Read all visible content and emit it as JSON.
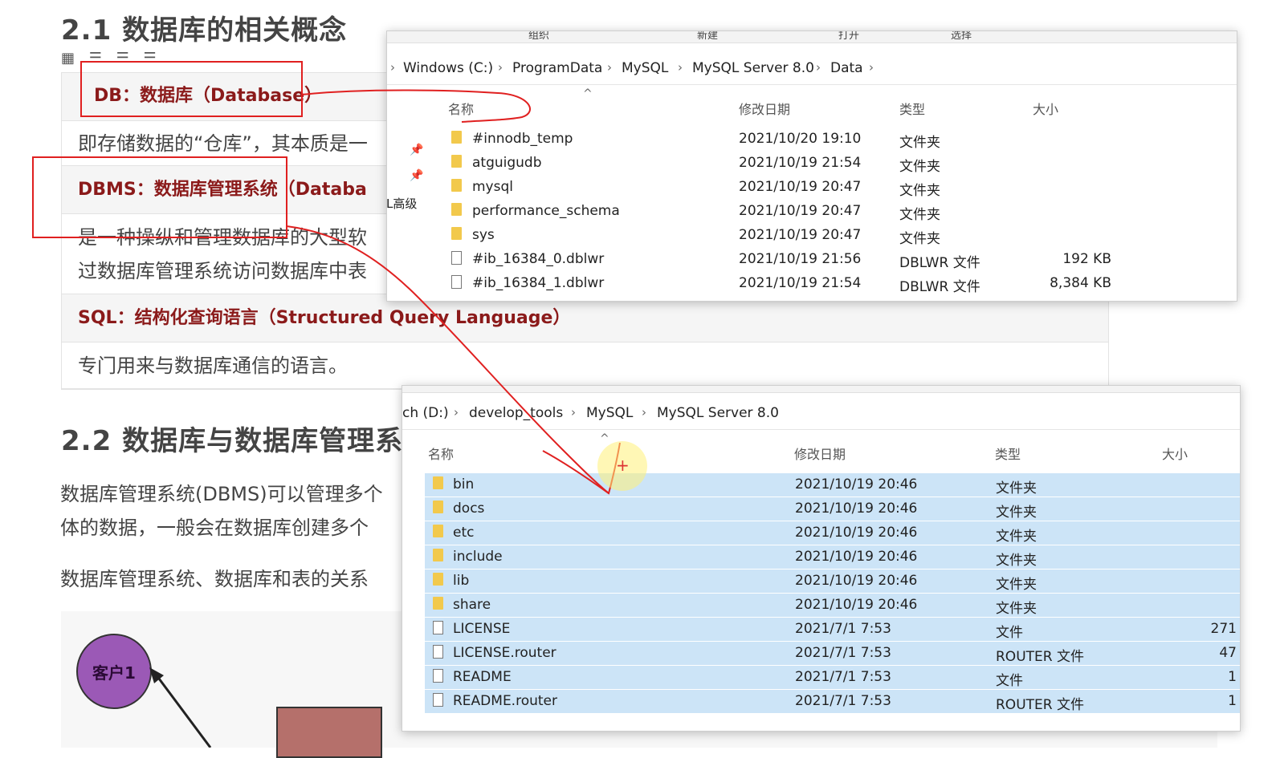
{
  "document": {
    "heading_21": "2.1 数据库的相关概念",
    "toolbar_icons": "▦ ☰ ☰ ☰",
    "definitions": [
      {
        "head": "DB：数据库（Database）",
        "body": "即存储数据的“仓库”，其本质是一"
      },
      {
        "head": "DBMS：数据库管理系统（Databa",
        "body": "是一种操纵和管理数据库的大型软",
        "body2": "过数据库管理系统访问数据库中表"
      },
      {
        "head": "SQL：结构化查询语言（Structured Query Language）",
        "body": "专门用来与数据库通信的语言。"
      }
    ],
    "heading_22": "2.2 数据库与数据库管理系",
    "para1_line1": "数据库管理系统(DBMS)可以管理多个",
    "para1_line2": "体的数据，一般会在数据库创建多个",
    "para2": "数据库管理系统、数据库和表的关系",
    "diagram": {
      "client_label": "客户1"
    }
  },
  "explorer_top": {
    "ribbon": [
      "组织",
      "新建",
      "打开",
      "选择"
    ],
    "breadcrumb": [
      "Windows (C:)",
      "ProgramData",
      "MySQL",
      "MySQL Server 8.0",
      "Data"
    ],
    "side_fragment": "L高级",
    "columns": {
      "name": "名称",
      "date": "修改日期",
      "type": "类型",
      "size": "大小"
    },
    "rows": [
      {
        "name": "#innodb_temp",
        "date": "2021/10/20 19:10",
        "type": "文件夹",
        "size": "",
        "kind": "folder"
      },
      {
        "name": "atguigudb",
        "date": "2021/10/19 21:54",
        "type": "文件夹",
        "size": "",
        "kind": "folder"
      },
      {
        "name": "mysql",
        "date": "2021/10/19 20:47",
        "type": "文件夹",
        "size": "",
        "kind": "folder"
      },
      {
        "name": "performance_schema",
        "date": "2021/10/19 20:47",
        "type": "文件夹",
        "size": "",
        "kind": "folder"
      },
      {
        "name": "sys",
        "date": "2021/10/19 20:47",
        "type": "文件夹",
        "size": "",
        "kind": "folder"
      },
      {
        "name": "#ib_16384_0.dblwr",
        "date": "2021/10/19 21:56",
        "type": "DBLWR 文件",
        "size": "192 KB",
        "kind": "file"
      },
      {
        "name": "#ib_16384_1.dblwr",
        "date": "2021/10/19 21:54",
        "type": "DBLWR 文件",
        "size": "8,384 KB",
        "kind": "file"
      }
    ]
  },
  "explorer_bottom": {
    "breadcrumb": [
      "ch (D:)",
      "develop_tools",
      "MySQL",
      "MySQL Server 8.0"
    ],
    "columns": {
      "name": "名称",
      "date": "修改日期",
      "type": "类型",
      "size": "大小"
    },
    "rows": [
      {
        "name": "bin",
        "date": "2021/10/19 20:46",
        "type": "文件夹",
        "size": "",
        "kind": "folder"
      },
      {
        "name": "docs",
        "date": "2021/10/19 20:46",
        "type": "文件夹",
        "size": "",
        "kind": "folder"
      },
      {
        "name": "etc",
        "date": "2021/10/19 20:46",
        "type": "文件夹",
        "size": "",
        "kind": "folder"
      },
      {
        "name": "include",
        "date": "2021/10/19 20:46",
        "type": "文件夹",
        "size": "",
        "kind": "folder"
      },
      {
        "name": "lib",
        "date": "2021/10/19 20:46",
        "type": "文件夹",
        "size": "",
        "kind": "folder"
      },
      {
        "name": "share",
        "date": "2021/10/19 20:46",
        "type": "文件夹",
        "size": "",
        "kind": "folder"
      },
      {
        "name": "LICENSE",
        "date": "2021/7/1 7:53",
        "type": "文件",
        "size": "271",
        "kind": "file"
      },
      {
        "name": "LICENSE.router",
        "date": "2021/7/1 7:53",
        "type": "ROUTER 文件",
        "size": "47",
        "kind": "file"
      },
      {
        "name": "README",
        "date": "2021/7/1 7:53",
        "type": "文件",
        "size": "1",
        "kind": "file"
      },
      {
        "name": "README.router",
        "date": "2021/7/1 7:53",
        "type": "ROUTER 文件",
        "size": "1",
        "kind": "file"
      }
    ]
  },
  "colors": {
    "annotation_red": "#e02020",
    "selection_blue": "#cce4f7",
    "folder_yellow": "#f2c94c",
    "heading_red": "#8b1a1a"
  }
}
